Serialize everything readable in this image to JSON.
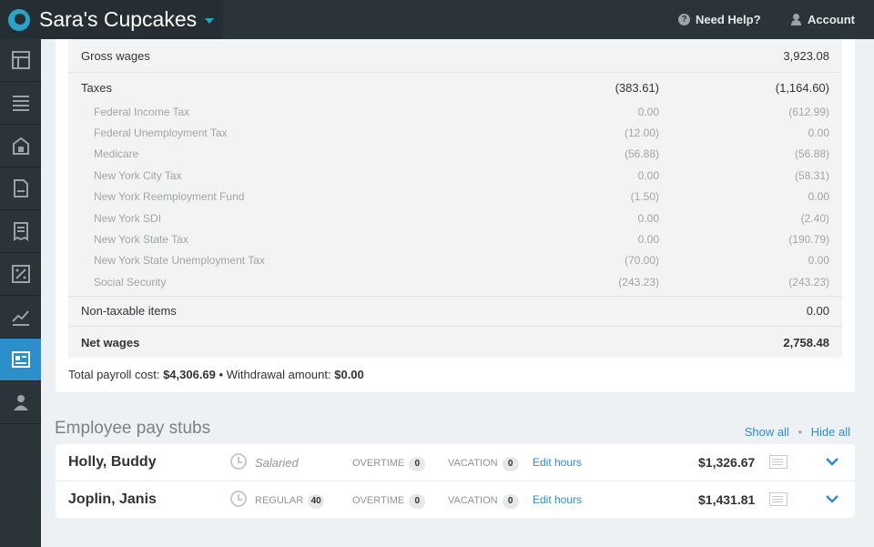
{
  "header": {
    "company": "Sara's Cupcakes",
    "help": "Need Help?",
    "account": "Account"
  },
  "sidebar": {
    "items": [
      {
        "icon": "dashboard-icon"
      },
      {
        "icon": "list-icon"
      },
      {
        "icon": "store-icon"
      },
      {
        "icon": "document-icon"
      },
      {
        "icon": "receipt-icon"
      },
      {
        "icon": "tax-icon"
      },
      {
        "icon": "reports-icon"
      },
      {
        "icon": "payroll-icon",
        "active": true
      },
      {
        "icon": "employees-icon"
      }
    ]
  },
  "summary": {
    "gross_wages": {
      "label": "Gross wages",
      "total": "3,923.08"
    },
    "taxes": {
      "label": "Taxes",
      "col1": "(383.61)",
      "col2": "(1,164.60)",
      "items": [
        {
          "label": "Federal Income Tax",
          "col1": "0.00",
          "col2": "(612.99)"
        },
        {
          "label": "Federal Unemployment Tax",
          "col1": "(12.00)",
          "col2": "0.00"
        },
        {
          "label": "Medicare",
          "col1": "(56.88)",
          "col2": "(56.88)"
        },
        {
          "label": "New York City Tax",
          "col1": "0.00",
          "col2": "(58.31)"
        },
        {
          "label": "New York Reemployment Fund",
          "col1": "(1.50)",
          "col2": "0.00"
        },
        {
          "label": "New York SDI",
          "col1": "0.00",
          "col2": "(2.40)"
        },
        {
          "label": "New York State Tax",
          "col1": "0.00",
          "col2": "(190.79)"
        },
        {
          "label": "New York State Unemployment Tax",
          "col1": "(70.00)",
          "col2": "0.00"
        },
        {
          "label": "Social Security",
          "col1": "(243.23)",
          "col2": "(243.23)"
        }
      ]
    },
    "non_taxable": {
      "label": "Non-taxable items",
      "total": "0.00"
    },
    "net_wages": {
      "label": "Net wages",
      "total": "2,758.48"
    },
    "footer": {
      "payroll_label": "Total payroll cost:",
      "payroll_value": "$4,306.69",
      "separator": "•",
      "withdrawal_label": "Withdrawal amount:",
      "withdrawal_value": "$0.00"
    }
  },
  "paystubs": {
    "title": "Employee pay stubs",
    "show_all": "Show all",
    "separator": "•",
    "hide_all": "Hide all",
    "employees": [
      {
        "name": "Holly, Buddy",
        "type": "Salaried",
        "overtime_label": "OVERTIME",
        "overtime": "0",
        "vacation_label": "VACATION",
        "vacation": "0",
        "edit_label": "Edit hours",
        "amount": "$1,326.67"
      },
      {
        "name": "Joplin, Janis",
        "type": "REGULAR",
        "regular": "40",
        "overtime_label": "OVERTIME",
        "overtime": "0",
        "vacation_label": "VACATION",
        "vacation": "0",
        "edit_label": "Edit hours",
        "amount": "$1,431.81"
      }
    ]
  },
  "colors": {
    "accent": "#2c8fc9",
    "topbar": "#2b3438"
  }
}
